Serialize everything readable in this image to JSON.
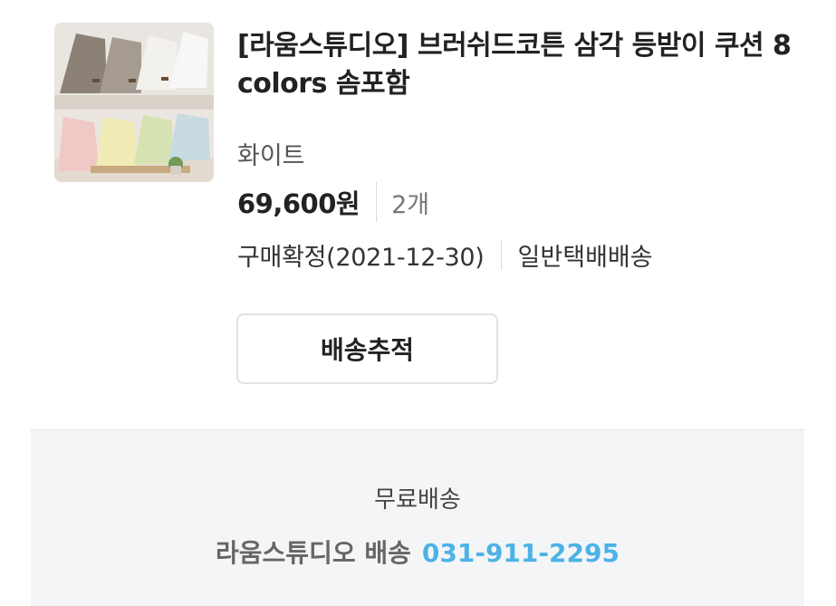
{
  "product": {
    "title": "[라움스튜디오] 브러쉬드코튼 삼각 등받이 쿠션 8 colors 솜포함",
    "option": "화이트",
    "price": "69,600원",
    "quantity": "2개",
    "status": "구매확정(2021-12-30)",
    "shipping_type": "일반택배배송"
  },
  "actions": {
    "track_label": "배송추적"
  },
  "shipping": {
    "fee_label": "무료배송",
    "seller_label": "라움스튜디오 배송",
    "seller_phone": "031-911-2295"
  },
  "colors": {
    "text_primary": "#222222",
    "text_secondary": "#555555",
    "phone_accent": "#4cb3e6",
    "panel_bg": "#f4f5f7"
  },
  "icons": {
    "product_image": "product-thumbnail-image"
  }
}
